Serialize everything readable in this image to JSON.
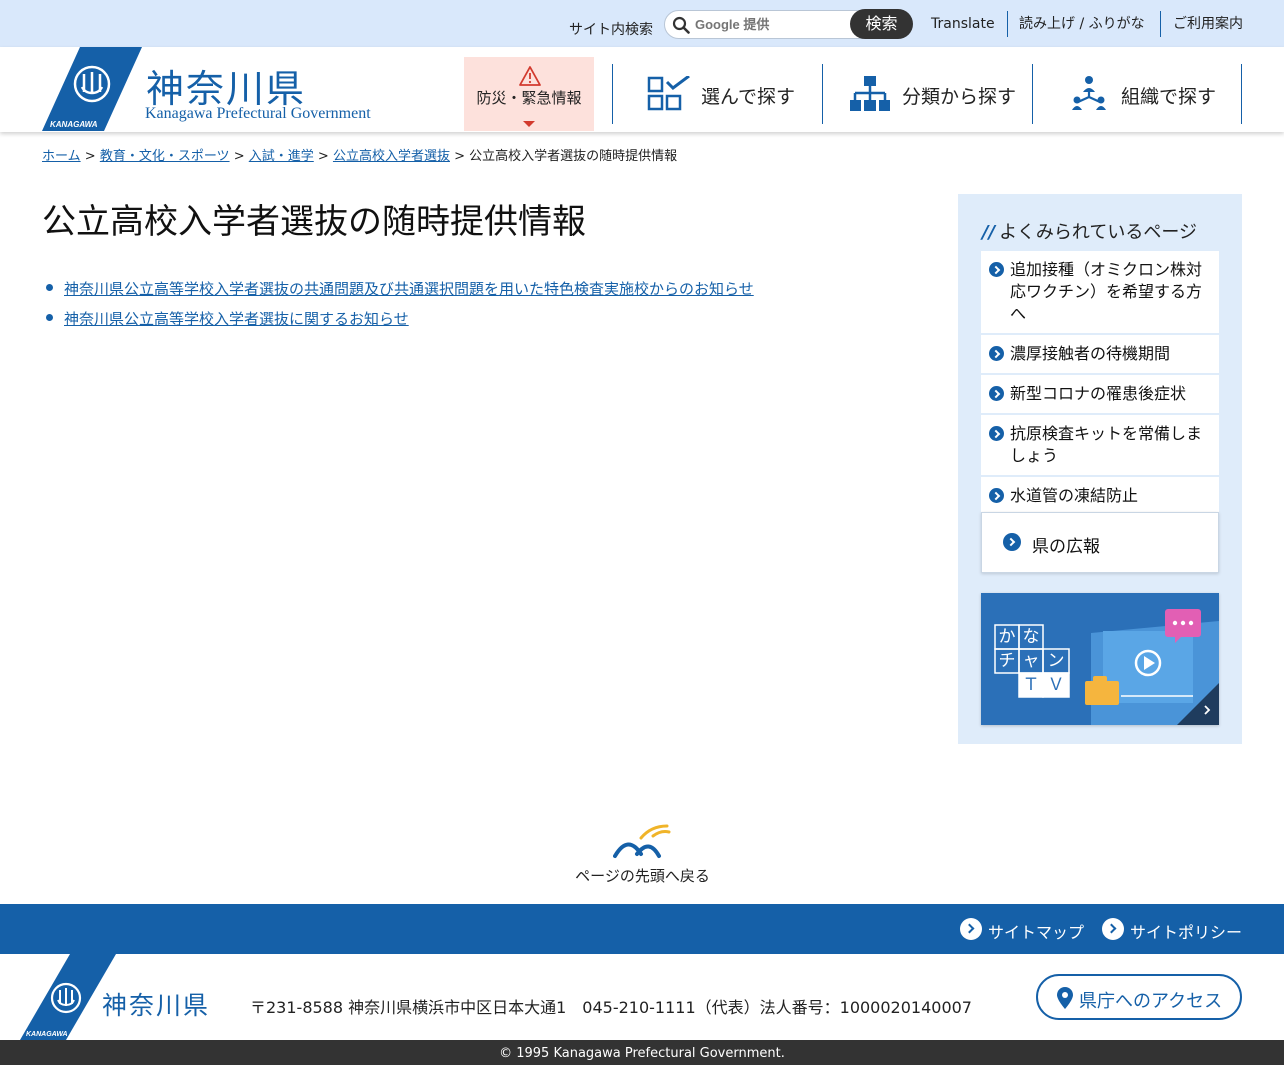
{
  "topbar": {
    "site_search_label": "サイト内検索",
    "search_placeholder": "Google 提供",
    "search_button": "検索",
    "translate": "Translate",
    "read_aloud": "読み上げ / ふりがな",
    "guide": "ご利用案内"
  },
  "header": {
    "logo_name": "神奈川県",
    "logo_sub": "Kanagawa Prefectural Government",
    "logo_mark_text": "KANAGAWA",
    "disaster_label": "防災・緊急情報",
    "nav": [
      {
        "label": "選んで探す",
        "icon": "checklist-grid-icon"
      },
      {
        "label": "分類から探す",
        "icon": "hierarchy-icon"
      },
      {
        "label": "組織で探す",
        "icon": "organization-icon"
      }
    ]
  },
  "breadcrumb": {
    "items": [
      "ホーム",
      "教育・文化・スポーツ",
      "入試・進学",
      "公立高校入学者選抜"
    ],
    "current": "公立高校入学者選抜の随時提供情報",
    "separator": ">"
  },
  "main": {
    "title": "公立高校入学者選抜の随時提供情報",
    "links": [
      "神奈川県公立高等学校入学者選抜の共通問題及び共通選択問題を用いた特色検査実施校からのお知らせ",
      "神奈川県公立高等学校入学者選抜に関するお知らせ"
    ]
  },
  "sidebar": {
    "popular_heading": "よくみられているページ",
    "popular": [
      "追加接種（オミクロン株対応ワクチン）を希望する方へ",
      "濃厚接触者の待機期間",
      "新型コロナの罹患後症状",
      "抗原検査キットを常備しましょう",
      "水道管の凍結防止"
    ],
    "pr_label": "県の広報",
    "banner": {
      "chars": [
        "か",
        "な",
        "チ",
        "ャ",
        "ン",
        "Ｔ",
        "Ｖ"
      ]
    }
  },
  "back_to_top": "ページの先頭へ戻る",
  "footer": {
    "links": [
      "サイトマップ",
      "サイトポリシー"
    ],
    "logo_name": "神奈川県",
    "address": "〒231-8588 神奈川県横浜市中区日本大通1　045-210-1111（代表）法人番号：1000020140007",
    "access_button": "県庁へのアクセス",
    "copyright": "© 1995 Kanagawa Prefectural Government."
  },
  "colors": {
    "brand_blue": "#1560a8",
    "topbar_bg": "#d9e8fb",
    "alert_bg": "#fde1dc",
    "alert_red": "#d23a2e"
  }
}
